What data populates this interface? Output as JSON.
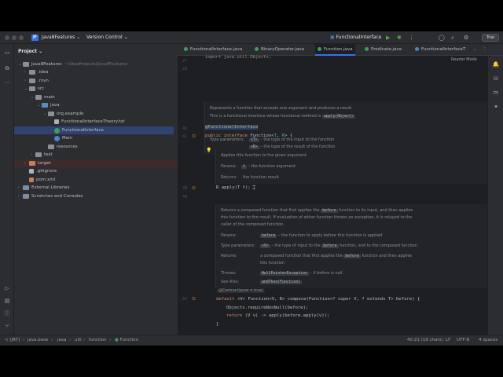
{
  "titlebar": {
    "project_badge": "JF",
    "project_name": "Java8Features",
    "vcs": "Version Control",
    "run_config": "FunctionalInterface",
    "trial": "Trial"
  },
  "project_panel": {
    "title": "Project",
    "items": [
      {
        "label": "Java8Features",
        "hint": "~/IdeaProjects/Java8Features"
      },
      {
        "label": ".idea"
      },
      {
        "label": ".mvn"
      },
      {
        "label": "src"
      },
      {
        "label": "main"
      },
      {
        "label": "java"
      },
      {
        "label": "org.example"
      },
      {
        "label": "FunctionalInterfaceTheory.txt"
      },
      {
        "label": "FunctionalInterface"
      },
      {
        "label": "Main"
      },
      {
        "label": "resources"
      },
      {
        "label": "test"
      },
      {
        "label": "target"
      },
      {
        "label": ".gitignore"
      },
      {
        "label": "pom.xml"
      },
      {
        "label": "External Libraries"
      },
      {
        "label": "Scratches and Consoles"
      }
    ]
  },
  "tabs": [
    {
      "label": "FunctionalInterface.java",
      "color": "#3f9c5f"
    },
    {
      "label": "BinaryOperator.java",
      "color": "#3f9c5f"
    },
    {
      "label": "Function.java",
      "color": "#3f9c5f",
      "active": true
    },
    {
      "label": "Predicate.java",
      "color": "#3f9c5f"
    },
    {
      "label": "FunctionalInterfaceT",
      "color": "#4a85c4"
    }
  ],
  "editor": {
    "reader_mode": "Reader Mode",
    "line_numbers": [
      "27",
      "28",
      "40",
      "41",
      "48",
      "49",
      "60"
    ],
    "top_import": "import java.util.Objects;",
    "doc1": {
      "line1": "Represents a function that accepts one argument and produces a result.",
      "line2a": "This is a functional interface whose functional method is",
      "line2code": "apply(Object)",
      "since_label": "Since:",
      "since_value": "1.8",
      "tp_label": "Type parameters:",
      "tp1_code": "<T>",
      "tp1_text": "– the type of the input to the function",
      "tp2_code": "<R>",
      "tp2_text": "– the type of the result of the function"
    },
    "annotation": "@FunctionalInterface",
    "decl": {
      "kw1": "public",
      "kw2": "interface",
      "name": "Function<",
      "t": "T",
      "comma": ", ",
      "r": "R",
      "end": "> {"
    },
    "doc2": {
      "line1": "Applies this function to the given argument.",
      "params_label": "Params:",
      "params_code": "t",
      "params_text": "– the function argument",
      "returns_label": "Returns:",
      "returns_text": "the function result"
    },
    "apply_line": "R apply(T t);",
    "doc3": {
      "line1a": "Returns a composed function that first applies the",
      "line1code": "before",
      "line1b": "function to its input, and then applies",
      "line2": "this function to the result. If evaluation of either function throws an exception, it is relayed to the",
      "line3": "caller of the composed function.",
      "params_label": "Params:",
      "params_code": "before",
      "params_text": "– the function to apply before this function is applied",
      "tp_label": "Type parameters:",
      "tp_code": "<V>",
      "tp_text_a": "– the type of input to the",
      "tp_code2": "before",
      "tp_text_b": "function, and to the composed function",
      "returns_label": "Returns:",
      "returns_a": "a composed function that first applies the",
      "returns_code": "before",
      "returns_b": "function and then applies",
      "returns_c": "this function",
      "throws_label": "Throws:",
      "throws_code": "NullPointerException",
      "throws_text": "– if before is null",
      "see_label": "See Also:",
      "see_code": "andThen(Function)"
    },
    "contract": "@Contract(pure = true)",
    "compose_line": {
      "kw": "default",
      "sig": " <V> Function<V, R> compose(Function<? super V, ? extends T> before) {"
    },
    "body1": "Objects.requireNonNull(before);",
    "body2": {
      "kw": "return",
      "rest": " (V v) -> apply(before.apply(v));"
    },
    "close": "}"
  },
  "statusbar": {
    "crumbs": [
      "< [JRT]",
      "java.base",
      "java",
      "util",
      "function",
      "Function"
    ],
    "position": "40:21 (19 chars)",
    "line_sep": "LF",
    "encoding": "UTF-8",
    "indent": "4 spaces"
  }
}
